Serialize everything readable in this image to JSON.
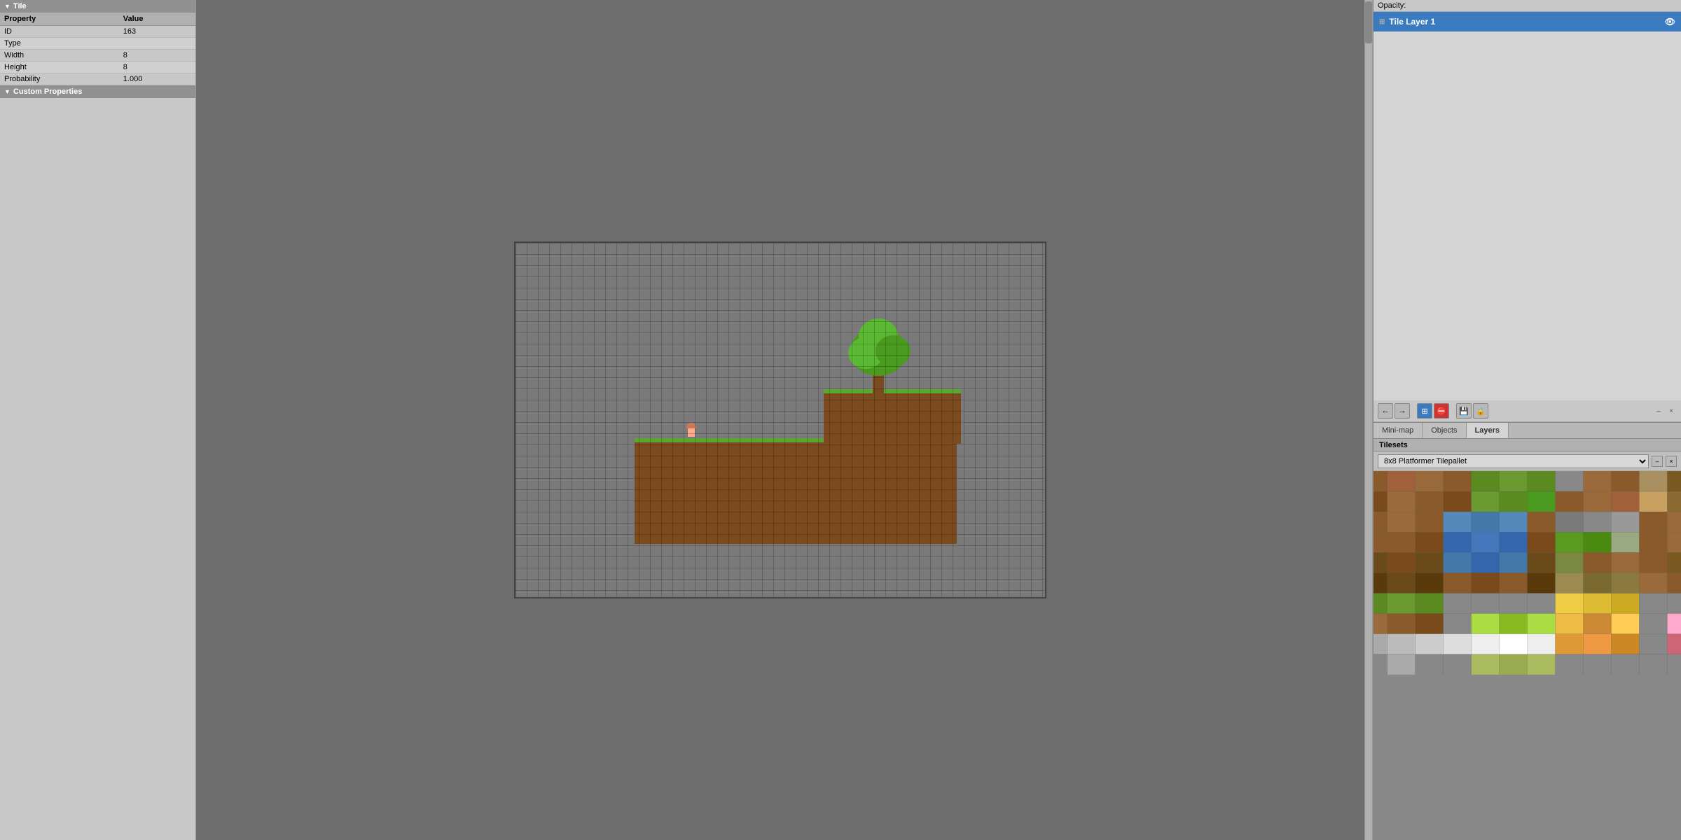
{
  "left": {
    "section_tile": "Tile",
    "columns": [
      "Property",
      "Value"
    ],
    "rows": [
      {
        "property": "ID",
        "value": "163"
      },
      {
        "property": "Type",
        "value": ""
      },
      {
        "property": "Width",
        "value": "8"
      },
      {
        "property": "Height",
        "value": "8"
      },
      {
        "property": "Probability",
        "value": "1.000"
      }
    ],
    "custom_properties_label": "Custom Properties"
  },
  "right": {
    "opacity_label": "Opacity:",
    "layer_name": "Tile Layer 1",
    "tabs": [
      "Mini-map",
      "Objects",
      "Layers"
    ],
    "active_tab": "Layers",
    "tilesets_label": "Tilesets",
    "tileset_name": "8x8 Platformer Tilepallet",
    "corner_icons": [
      "×",
      "×"
    ]
  },
  "toolbar": {
    "tools": [
      "←",
      "→",
      "⊞",
      "⛔",
      "💾",
      "🔒"
    ]
  }
}
